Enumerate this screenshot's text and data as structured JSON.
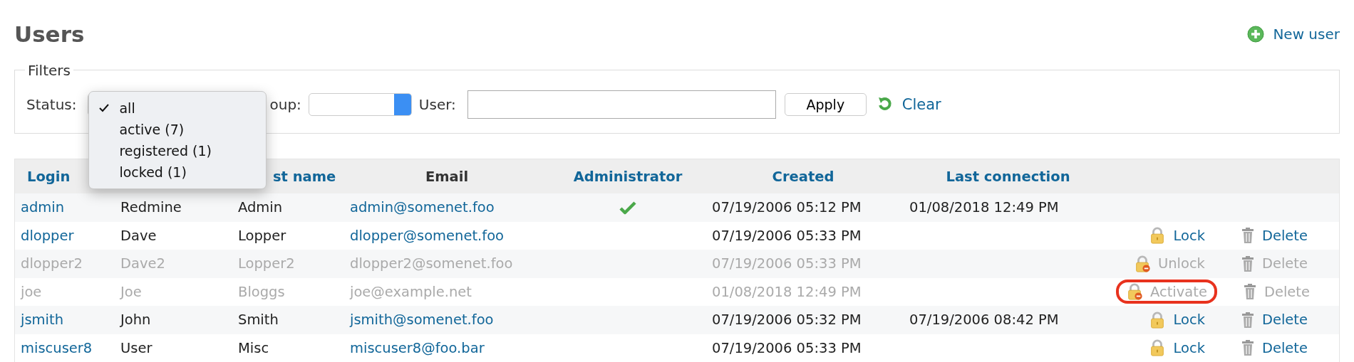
{
  "page": {
    "title": "Users",
    "new_user": "New user"
  },
  "filters": {
    "legend": "Filters",
    "status_label": "Status:",
    "status_menu": [
      {
        "label": "all",
        "selected": true
      },
      {
        "label": "active (7)",
        "selected": false
      },
      {
        "label": "registered (1)",
        "selected": false
      },
      {
        "label": "locked (1)",
        "selected": false
      }
    ],
    "group_label": "oup:",
    "user_label": "User:",
    "apply": "Apply",
    "clear": "Clear"
  },
  "table": {
    "columns": [
      {
        "label": "Login",
        "sortable": true
      },
      {
        "label": "st name",
        "sortable": true
      },
      {
        "label": "Email",
        "sortable": false
      },
      {
        "label": "Administrator",
        "sortable": true
      },
      {
        "label": "Created",
        "sortable": true
      },
      {
        "label": "Last connection",
        "sortable": true
      }
    ],
    "rows": [
      {
        "login": "admin",
        "first": "Redmine",
        "last": "Admin",
        "email": "admin@somenet.foo",
        "admin": true,
        "created": "07/19/2006 05:12 PM",
        "last_connection": "01/08/2018 12:49 PM",
        "inactive": false
      },
      {
        "login": "dlopper",
        "first": "Dave",
        "last": "Lopper",
        "email": "dlopper@somenet.foo",
        "admin": false,
        "created": "07/19/2006 05:33 PM",
        "inactive": false,
        "action": {
          "kind": "lock",
          "label": "Lock",
          "highlighted": false
        },
        "delete": "Delete"
      },
      {
        "login": "dlopper2",
        "first": "Dave2",
        "last": "Lopper2",
        "email": "dlopper2@somenet.foo",
        "admin": false,
        "created": "07/19/2006 05:33 PM",
        "inactive": true,
        "action": {
          "kind": "unlock",
          "label": "Unlock",
          "highlighted": false
        },
        "delete": "Delete"
      },
      {
        "login": "joe",
        "first": "Joe",
        "last": "Bloggs",
        "email": "joe@example.net",
        "admin": false,
        "created": "01/08/2018 12:49 PM",
        "inactive": true,
        "action": {
          "kind": "activate",
          "label": "Activate",
          "highlighted": true
        },
        "delete": "Delete"
      },
      {
        "login": "jsmith",
        "first": "John",
        "last": "Smith",
        "email": "jsmith@somenet.foo",
        "admin": false,
        "created": "07/19/2006 05:32 PM",
        "last_connection": "07/19/2006 08:42 PM",
        "inactive": false,
        "action": {
          "kind": "lock",
          "label": "Lock",
          "highlighted": false
        },
        "delete": "Delete"
      },
      {
        "login": "miscuser8",
        "first": "User",
        "last": "Misc",
        "email": "miscuser8@foo.bar",
        "admin": false,
        "created": "07/19/2006 05:33 PM",
        "inactive": false,
        "action": {
          "kind": "lock",
          "label": "Lock",
          "highlighted": false
        },
        "delete": "Delete"
      }
    ]
  }
}
